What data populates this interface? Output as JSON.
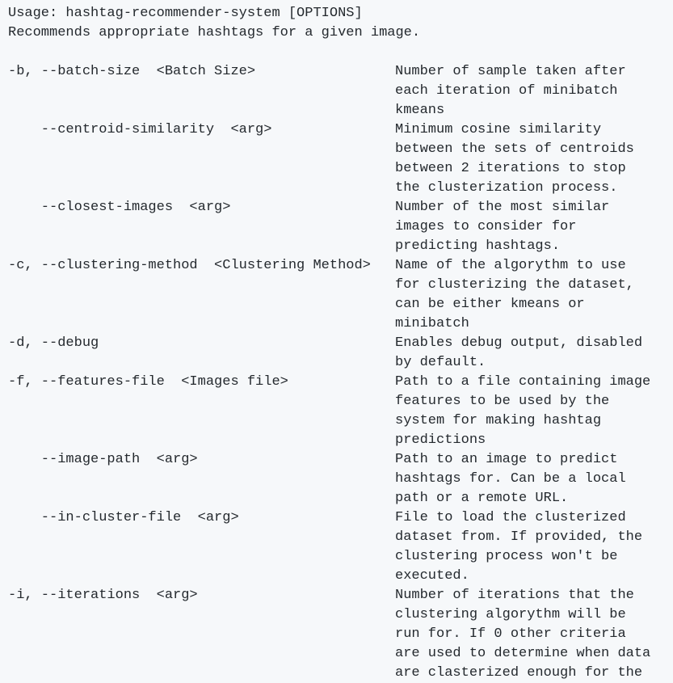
{
  "usage": "Usage: hashtag-recommender-system [OPTIONS]",
  "summary": "Recommends appropriate hashtags for a given image.",
  "options": [
    {
      "flag": "-b, --batch-size  <Batch Size>",
      "desc": [
        "Number of sample taken after",
        "each iteration of minibatch",
        "kmeans"
      ]
    },
    {
      "flag": "    --centroid-similarity  <arg>",
      "desc": [
        "Minimum cosine similarity",
        "between the sets of centroids",
        "between 2 iterations to stop",
        "the clusterization process."
      ]
    },
    {
      "flag": "    --closest-images  <arg>",
      "desc": [
        "Number of the most similar",
        "images to consider for",
        "predicting hashtags."
      ]
    },
    {
      "flag": "-c, --clustering-method  <Clustering Method>",
      "desc": [
        "Name of the algorythm to use",
        "for clusterizing the dataset,",
        "can be either kmeans or",
        "minibatch"
      ]
    },
    {
      "flag": "-d, --debug",
      "desc": [
        "Enables debug output, disabled",
        "by default."
      ]
    },
    {
      "flag": "-f, --features-file  <Images file>",
      "desc": [
        "Path to a file containing image",
        "features to be used by the",
        "system for making hashtag",
        "predictions"
      ]
    },
    {
      "flag": "    --image-path  <arg>",
      "desc": [
        "Path to an image to predict",
        "hashtags for. Can be a local",
        "path or a remote URL."
      ]
    },
    {
      "flag": "    --in-cluster-file  <arg>",
      "desc": [
        "File to load the clusterized",
        "dataset from. If provided, the",
        "clustering process won't be",
        "executed."
      ]
    },
    {
      "flag": "-i, --iterations  <arg>",
      "desc": [
        "Number of iterations that the",
        "clustering algorythm will be",
        "run for. If 0 other criteria",
        "are used to determine when data",
        "are clasterized enough for the"
      ]
    }
  ]
}
